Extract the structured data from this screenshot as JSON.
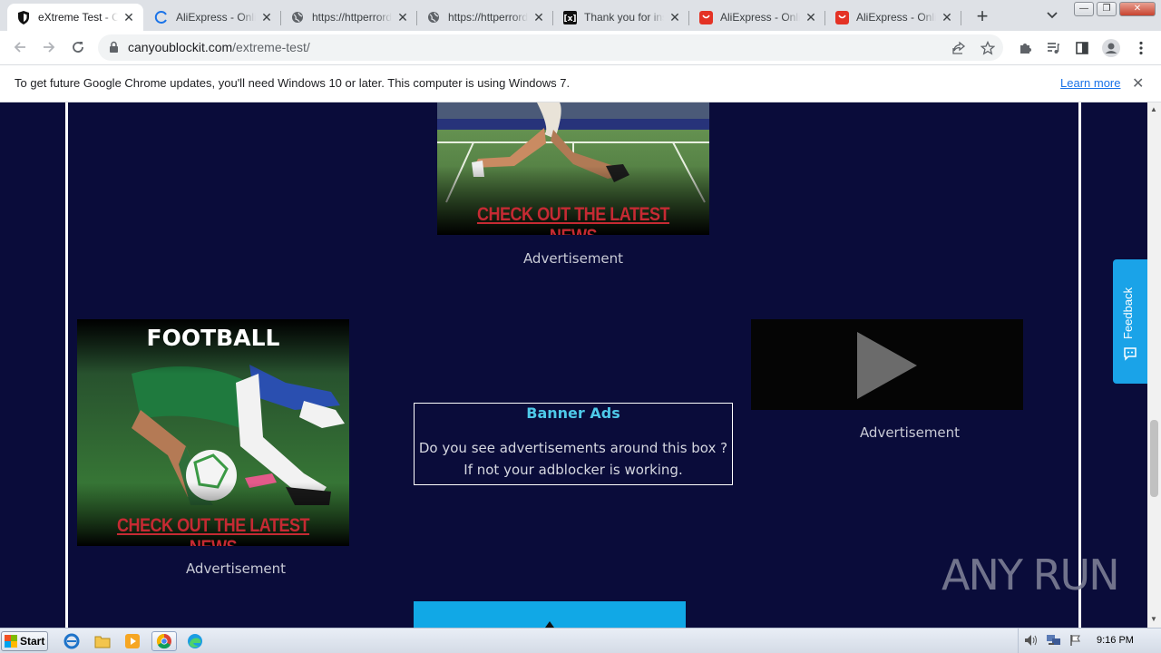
{
  "browser": {
    "tabs": [
      {
        "title": "eXtreme Test - Can You Block It",
        "favicon": "shield-icon",
        "active": true
      },
      {
        "title": "AliExpress - Online Shopping",
        "favicon": "loading-spinner-icon",
        "active": false
      },
      {
        "title": "https://httperrordetails",
        "favicon": "globe-icon",
        "active": false
      },
      {
        "title": "https://httperrordetails",
        "favicon": "globe-icon",
        "active": false
      },
      {
        "title": "Thank you for installing",
        "favicon": "brand-icon",
        "active": false
      },
      {
        "title": "AliExpress - Online Shopping",
        "favicon": "aliexpress-icon",
        "active": false
      },
      {
        "title": "AliExpress - Online Shopping",
        "favicon": "aliexpress-icon",
        "active": false
      }
    ],
    "address": {
      "domain": "canyoublockit.com",
      "path": "/extreme-test/"
    },
    "infobar": {
      "message": "To get future Google Chrome updates, you'll need Windows 10 or later. This computer is using Windows 7.",
      "link": "Learn more"
    }
  },
  "page": {
    "top_ad": {
      "cta": "CHECK OUT THE LATEST NEWS",
      "label": "Advertisement"
    },
    "left_ad": {
      "heading": "FOOTBALL",
      "cta": "CHECK OUT THE LATEST NEWS",
      "label": "Advertisement"
    },
    "banner": {
      "title": "Banner Ads",
      "line1": "Do you see advertisements around this box ?",
      "line2": "If not your adblocker is working."
    },
    "right_ad": {
      "label": "Advertisement"
    },
    "feedback": "Feedback",
    "watermark": "ANY RUN"
  },
  "taskbar": {
    "start": "Start",
    "clock": "9:16 PM"
  },
  "colors": {
    "page_bg": "#0a0c3a",
    "banner_title": "#4ec9e8",
    "cta_red": "#c52a33",
    "feedback_blue": "#1aa3e8"
  }
}
